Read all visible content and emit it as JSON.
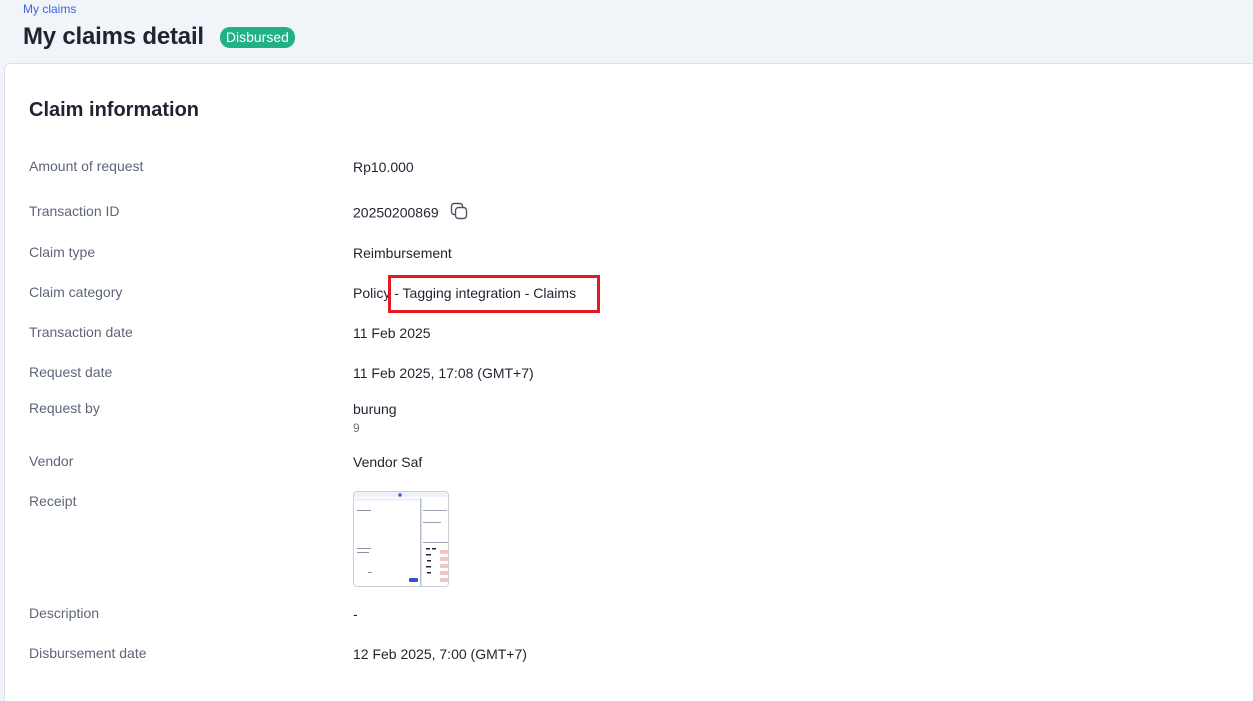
{
  "breadcrumb": "My claims",
  "page_title": "My claims detail",
  "status_badge": "Disbursed",
  "section_title": "Claim information",
  "fields": {
    "amount": {
      "label": "Amount of request",
      "value": "Rp10.000"
    },
    "transaction_id": {
      "label": "Transaction ID",
      "value": "20250200869",
      "icon": "copy-icon"
    },
    "claim_type": {
      "label": "Claim type",
      "value": "Reimbursement"
    },
    "claim_category": {
      "label": "Claim category",
      "value": "Policy - Tagging integration - Claims"
    },
    "transaction_date": {
      "label": "Transaction date",
      "value": "11 Feb 2025"
    },
    "request_date": {
      "label": "Request date",
      "value": "11 Feb 2025, 17:08 (GMT+7)"
    },
    "request_by": {
      "label": "Request by",
      "value": "burung",
      "sub": "9"
    },
    "vendor": {
      "label": "Vendor",
      "value": "Vendor Saf"
    },
    "receipt": {
      "label": "Receipt"
    },
    "description": {
      "label": "Description",
      "value": "-"
    },
    "disbursement_date": {
      "label": "Disbursement date",
      "value": "12 Feb 2025, 7:00 (GMT+7)"
    }
  },
  "colors": {
    "link": "#3d63dd",
    "badge": "#20b286",
    "highlight": "#e31a24"
  }
}
